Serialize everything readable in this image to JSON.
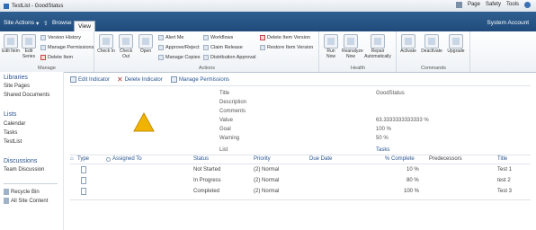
{
  "browser": {
    "tab_title": "TestList - GoodStatus",
    "tools": [
      "Page",
      "Safety",
      "Tools"
    ]
  },
  "ribbon_tabs": {
    "site_actions": "Site Actions",
    "browse": "Browse",
    "view": "View",
    "user": "System Account"
  },
  "ribbon": {
    "manage": {
      "edit_item": "Edit Item",
      "edit_series": "Edit Series",
      "version_history": "Version History",
      "manage_permissions": "Manage Permissions",
      "delete_item": "Delete Item",
      "label": "Manage"
    },
    "actions": {
      "check_in": "Check In",
      "check_out": "Check Out",
      "open": "Open",
      "alert_me": "Alert Me",
      "approve_reject": "Approve/Reject",
      "manage_copies": "Manage Copies",
      "workflows": "Workflows",
      "claim_release": "Claim Release",
      "distribution_approval": "Distribution Approval",
      "delete_item_version": "Delete Item Version",
      "restore_item_version": "Restore Item Version",
      "label": "Actions"
    },
    "health": {
      "run_now": "Run Now",
      "reanalyze_now": "Reanalyze Now",
      "repair_automatically": "Repair Automatically",
      "label": "Health"
    },
    "commands": {
      "activate": "Activate",
      "deactivate": "Deactivate",
      "upgrade": "Upgrade",
      "label": "Commands"
    }
  },
  "leftnav": {
    "libraries_heading": "Libraries",
    "libraries": [
      "Site Pages",
      "Shared Documents"
    ],
    "lists_heading": "Lists",
    "lists": [
      "Calendar",
      "Tasks",
      "TestList"
    ],
    "discussions_heading": "Discussions",
    "discussions": [
      "Team Discussion"
    ],
    "recycle_bin": "Recycle Bin",
    "all_site_content": "All Site Content"
  },
  "toolbar": {
    "edit_indicator": "Edit Indicator",
    "delete_indicator": "Delete Indicator",
    "manage_permissions": "Manage Permissions"
  },
  "properties": [
    {
      "label": "Title",
      "value": "GoodStatus"
    },
    {
      "label": "Description",
      "value": ""
    },
    {
      "label": "Comments",
      "value": ""
    },
    {
      "label": "Value",
      "value": "63.3333333333333 %"
    },
    {
      "label": "Goal",
      "value": "100 %"
    },
    {
      "label": "Warning",
      "value": "50 %"
    },
    {
      "label": "List",
      "value": "Tasks"
    }
  ],
  "table": {
    "headers": [
      "Type",
      "Assigned To",
      "Status",
      "Priority",
      "Due Date",
      "% Complete",
      "Predecessors",
      "Title"
    ],
    "rows": [
      {
        "status": "Not Started",
        "priority": "(2) Normal",
        "complete": "10 %",
        "title": "Test 1"
      },
      {
        "status": "In Progress",
        "priority": "(2) Normal",
        "complete": "80 %",
        "title": "test 2"
      },
      {
        "status": "Completed",
        "priority": "(2) Normal",
        "complete": "100 %",
        "title": "Test 3"
      }
    ]
  },
  "colors": {
    "ribbon_bar": "#1f4b7a",
    "link": "#2a5591",
    "warning_indicator": "#f0b400"
  }
}
